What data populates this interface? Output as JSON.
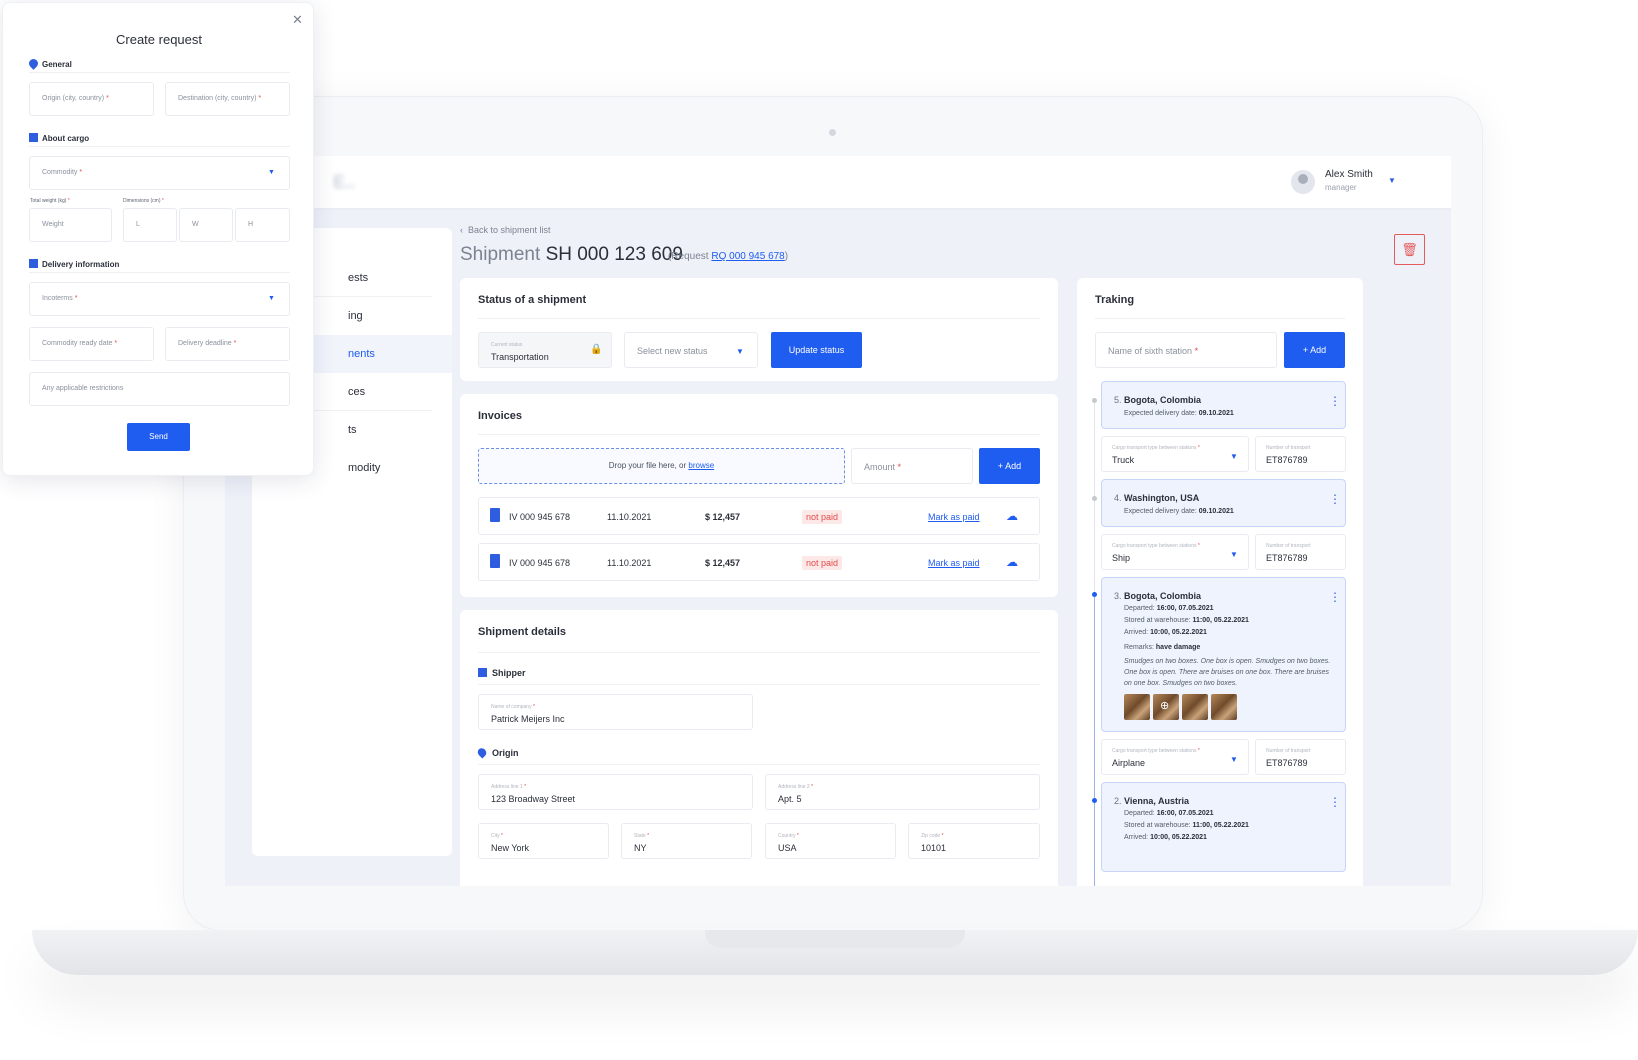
{
  "user": {
    "name": "Alex Smith",
    "role": "manager"
  },
  "sidebar": {
    "items": [
      {
        "label": "ests",
        "active": false
      },
      {
        "label": "ing",
        "active": false
      },
      {
        "label": "nents",
        "active": true
      },
      {
        "label": "ces",
        "active": false
      },
      {
        "label": "ts",
        "active": false
      },
      {
        "label": "modity",
        "active": false
      }
    ]
  },
  "shipment": {
    "back_label": "Back to shipment list",
    "title_prefix": "Shipment",
    "title_number": "SH 000 123 609",
    "request_prefix": "(Request",
    "request_link": "RQ 000 945 678",
    "request_suffix": ")"
  },
  "status_card": {
    "title": "Status of a shipment",
    "current_label": "Current status",
    "current_value": "Transportation",
    "select_placeholder": "Select new status",
    "update_button": "Update status"
  },
  "invoices": {
    "title": "Invoices",
    "drop_text": "Drop your file here, or",
    "browse_link": "browse",
    "amount_placeholder": "Amount",
    "add_button": "+ Add",
    "rows": [
      {
        "id": "IV 000 945 678",
        "date": "11.10.2021",
        "amount": "$ 12,457",
        "status": "not paid",
        "action": "Mark as paid"
      },
      {
        "id": "IV 000 945 678",
        "date": "11.10.2021",
        "amount": "$ 12,457",
        "status": "not paid",
        "action": "Mark as paid"
      }
    ]
  },
  "details": {
    "title": "Shipment details",
    "shipper_title": "Shipper",
    "company_label": "Name of company",
    "company_value": "Patrick Meijers Inc",
    "origin_title": "Origin",
    "addr1_label": "Address line 1",
    "addr1_value": "123 Broadway Street",
    "addr2_label": "Address line 2",
    "addr2_value": "Apt. 5",
    "city_label": "City",
    "city_value": "New York",
    "state_label": "State",
    "state_value": "NY",
    "country_label": "Country",
    "country_value": "USA",
    "zip_label": "Zip code",
    "zip_value": "10101"
  },
  "tracking": {
    "title": "Traking",
    "station_placeholder": "Name of sixth station",
    "add_button": "+ Add",
    "transport_label": "Cargo transport type between stations",
    "number_label": "Number of transport",
    "stations": [
      {
        "num": "5.",
        "name": "Bogota, Colombia",
        "expected_label": "Expected delivery date:",
        "expected": "09.10.2021"
      },
      {
        "transport": "Truck",
        "number": "ET876789"
      },
      {
        "num": "4.",
        "name": "Washington, USA",
        "expected_label": "Expected delivery date:",
        "expected": "09.10.2021"
      },
      {
        "transport": "Ship",
        "number": "ET876789"
      },
      {
        "num": "3.",
        "name": "Bogota, Colombia",
        "departed_label": "Departed:",
        "departed": "16:00, 07.05.2021",
        "stored_label": "Stored at warehouse:",
        "stored": "11:00, 05.22.2021",
        "arrived_label": "Arrived:",
        "arrived": "10:00, 05.22.2021",
        "remarks_label": "Remarks:",
        "remarks": "have damage",
        "note": "Smudges on two boxes. One box is open. Smudges on two boxes. One box is open. There are bruises on one box. There are bruises on one box. Smudges on two boxes."
      },
      {
        "transport": "Airplane",
        "number": "ET876789"
      },
      {
        "num": "2.",
        "name": "Vienna, Austria",
        "departed_label": "Departed:",
        "departed": "16:00, 07.05.2021",
        "stored_label": "Stored at warehouse:",
        "stored": "11:00, 05.22.2021",
        "arrived_label": "Arrived:",
        "arrived": "10:00, 05.22.2021"
      }
    ]
  },
  "modal": {
    "title": "Create request",
    "general": "General",
    "origin_ph": "Origin (city, country)",
    "destination_ph": "Destination (city, country)",
    "cargo": "About cargo",
    "commodity_ph": "Commodity",
    "weight_label": "Total weight (kg)",
    "dims_label": "Dimensions (cm)",
    "weight_ph": "Weight",
    "l_ph": "L",
    "w_ph": "W",
    "h_ph": "H",
    "delivery": "Delivery information",
    "incoterms_ph": "Incoterms",
    "ready_ph": "Commodity ready date",
    "deadline_ph": "Delivery deadline",
    "restrictions_ph": "Any applicable restrictions",
    "send_button": "Send",
    "required_mark": "*"
  },
  "colors": {
    "accent": "#1f5cf0",
    "danger": "#e24b4b",
    "panel": "#eef3fd"
  }
}
